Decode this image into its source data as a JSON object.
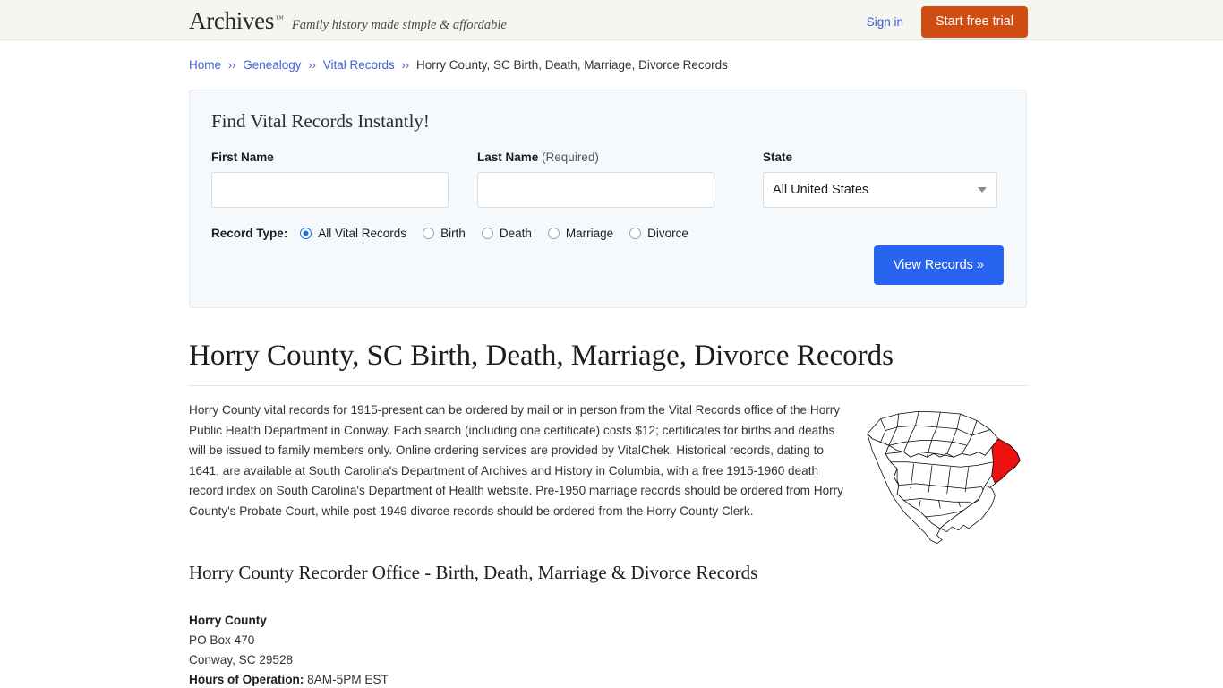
{
  "header": {
    "brand_name": "Archives",
    "brand_tm": "™",
    "tagline": "Family history made simple & affordable",
    "sign_in": "Sign in",
    "start_trial": "Start free trial",
    "trial_color": "#cf4d13",
    "link_color": "#3b5bd0"
  },
  "breadcrumb": {
    "sep": "››",
    "items": [
      {
        "label": "Home",
        "link": true
      },
      {
        "label": "Genealogy",
        "link": true
      },
      {
        "label": "Vital Records",
        "link": true
      },
      {
        "label": "Horry County, SC Birth, Death, Marriage, Divorce Records",
        "link": false
      }
    ]
  },
  "search": {
    "title": "Find Vital Records Instantly!",
    "first_name_label": "First Name",
    "first_name_value": "",
    "first_name_placeholder": "",
    "last_name_label": "Last Name",
    "last_name_required": "(Required)",
    "last_name_value": "",
    "last_name_placeholder": "",
    "state_label": "State",
    "state_value": "All United States",
    "state_options": [
      "All United States"
    ],
    "record_type_label": "Record Type:",
    "record_types": [
      {
        "label": "All Vital Records",
        "checked": true
      },
      {
        "label": "Birth",
        "checked": false
      },
      {
        "label": "Death",
        "checked": false
      },
      {
        "label": "Marriage",
        "checked": false
      },
      {
        "label": "Divorce",
        "checked": false
      }
    ],
    "submit_label": "View Records »",
    "submit_color": "#2864f0",
    "panel_bg": "#f6f9fc"
  },
  "main": {
    "page_title": "Horry County, SC Birth, Death, Marriage, Divorce Records",
    "intro_paragraph": "Horry County vital records for 1915-present can be ordered by mail or in person from the Vital Records office of the Horry Public Health Department in Conway. Each search (including one certificate) costs $12; certificates for births and deaths will be issued to family members only. Online ordering services are provided by VitalChek. Historical records, dating to 1641, are available at South Carolina's Department of Archives and History in Columbia, with a free 1915-1960 death record index on South Carolina's Department of Health website. Pre-1950 marriage records should be ordered from Horry County's Probate Court, while post-1949 divorce records should be ordered from the Horry County Clerk.",
    "map_alt": "Map of South Carolina counties with Horry County highlighted",
    "map_highlight_color": "#ee1111",
    "sub_heading": "Horry County Recorder Office - Birth, Death, Marriage & Divorce Records",
    "office": {
      "name": "Horry County",
      "address_line1": "PO Box 470",
      "address_line2": "Conway, SC 29528",
      "hours_label": "Hours of Operation:",
      "hours_value": "8AM-5PM EST"
    }
  }
}
